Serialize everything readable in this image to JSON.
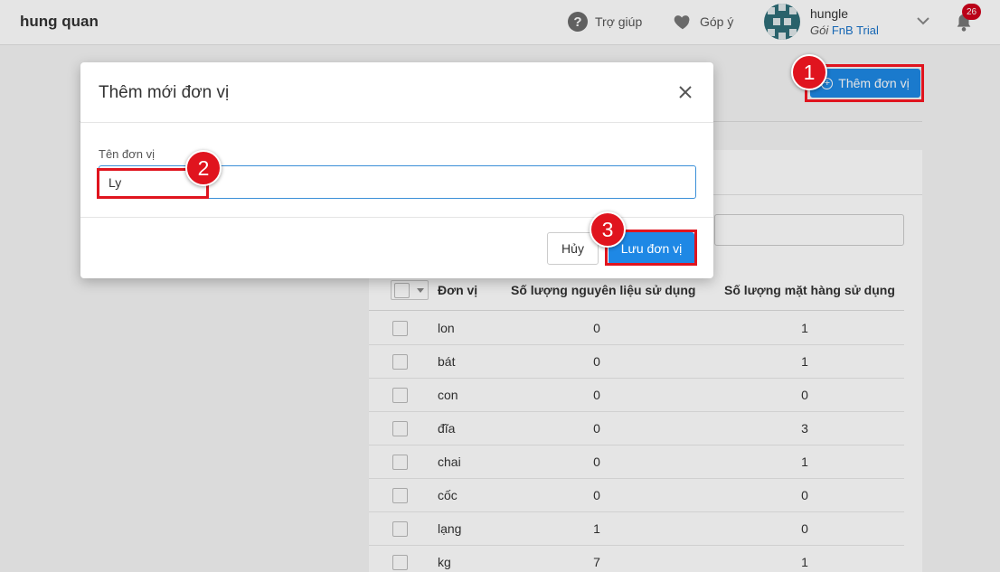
{
  "header": {
    "brand": "hung quan",
    "help_label": "Trợ giúp",
    "feedback_label": "Góp ý",
    "user_name": "hungle",
    "plan_prefix": "Gói",
    "plan_name": "FnB Trial",
    "notification_count": "26"
  },
  "page": {
    "add_unit_label": "Thêm đơn vị"
  },
  "table": {
    "columns": [
      "Đơn vị",
      "Số lượng nguyên liệu sử dụng",
      "Số lượng mặt hàng sử dụng"
    ],
    "rows": [
      {
        "unit": "lon",
        "ingredients": "0",
        "items": "1"
      },
      {
        "unit": "bát",
        "ingredients": "0",
        "items": "1"
      },
      {
        "unit": "con",
        "ingredients": "0",
        "items": "0"
      },
      {
        "unit": "đĩa",
        "ingredients": "0",
        "items": "3"
      },
      {
        "unit": "chai",
        "ingredients": "0",
        "items": "1"
      },
      {
        "unit": "cốc",
        "ingredients": "0",
        "items": "0"
      },
      {
        "unit": "lạng",
        "ingredients": "1",
        "items": "0"
      },
      {
        "unit": "kg",
        "ingredients": "7",
        "items": "1"
      }
    ]
  },
  "modal": {
    "title": "Thêm mới đơn vị",
    "field_label": "Tên đơn vị",
    "field_value": "Ly",
    "cancel_label": "Hủy",
    "save_label": "Lưu đơn vị"
  },
  "annotations": {
    "step1": "1",
    "step2": "2",
    "step3": "3"
  },
  "colors": {
    "primary": "#1e88e5",
    "highlight": "#e0141e",
    "badge": "#d0021b"
  },
  "icons": [
    "help-icon",
    "heart-icon",
    "chevron-down-icon",
    "bell-icon",
    "close-icon",
    "plus-circle-icon",
    "checkbox-icon",
    "caret-down-icon"
  ]
}
